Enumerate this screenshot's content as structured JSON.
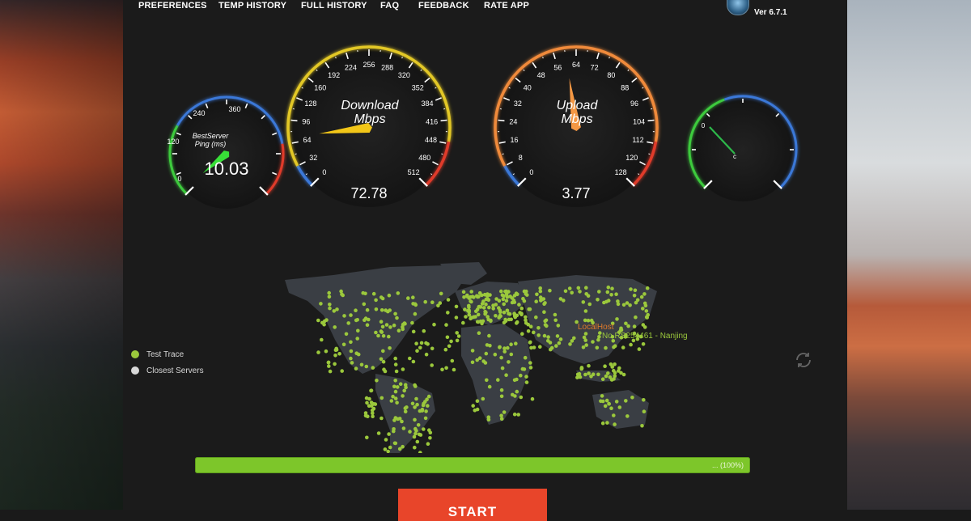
{
  "menu": {
    "items": [
      {
        "label": "PREFERENCES"
      },
      {
        "label": "TEMP HISTORY"
      },
      {
        "label": "FULL HISTORY"
      },
      {
        "label": "FAQ"
      },
      {
        "label": "FEEDBACK"
      },
      {
        "label": "RATE APP"
      }
    ]
  },
  "version": "Ver 6.7.1",
  "ping": {
    "title_line1": "BestServer",
    "title_line2": "Ping (ms)",
    "value": "10.03",
    "ticks": [
      "0",
      "120",
      "240",
      "360"
    ]
  },
  "download": {
    "title_line1": "Download",
    "title_line2": "Mbps",
    "value": "72.78",
    "ticks": [
      "0",
      "32",
      "64",
      "96",
      "128",
      "160",
      "192",
      "224",
      "256",
      "288",
      "320",
      "352",
      "384",
      "416",
      "448",
      "480",
      "512"
    ]
  },
  "upload": {
    "title_line1": "Upload",
    "title_line2": "Mbps",
    "value": "3.77",
    "ticks": [
      "0",
      "8",
      "16",
      "24",
      "32",
      "40",
      "48",
      "56",
      "64",
      "72",
      "80",
      "88",
      "96",
      "104",
      "112",
      "120",
      "128"
    ]
  },
  "temp": {
    "tick_zero": "0",
    "unit": "c"
  },
  "map": {
    "localhost_label": "LocalHost",
    "server_label": "No.RS254461 - Nanjing"
  },
  "legend": {
    "test_trace": "Test Trace",
    "closest_servers": "Closest Servers"
  },
  "colors": {
    "trace": "#9bc83c",
    "closest": "#d8d8d8",
    "progress": "#7dc62a",
    "start": "#e8452a"
  },
  "progress": {
    "text": "... (100%)",
    "fraction": 1.0
  },
  "start_label": "START"
}
